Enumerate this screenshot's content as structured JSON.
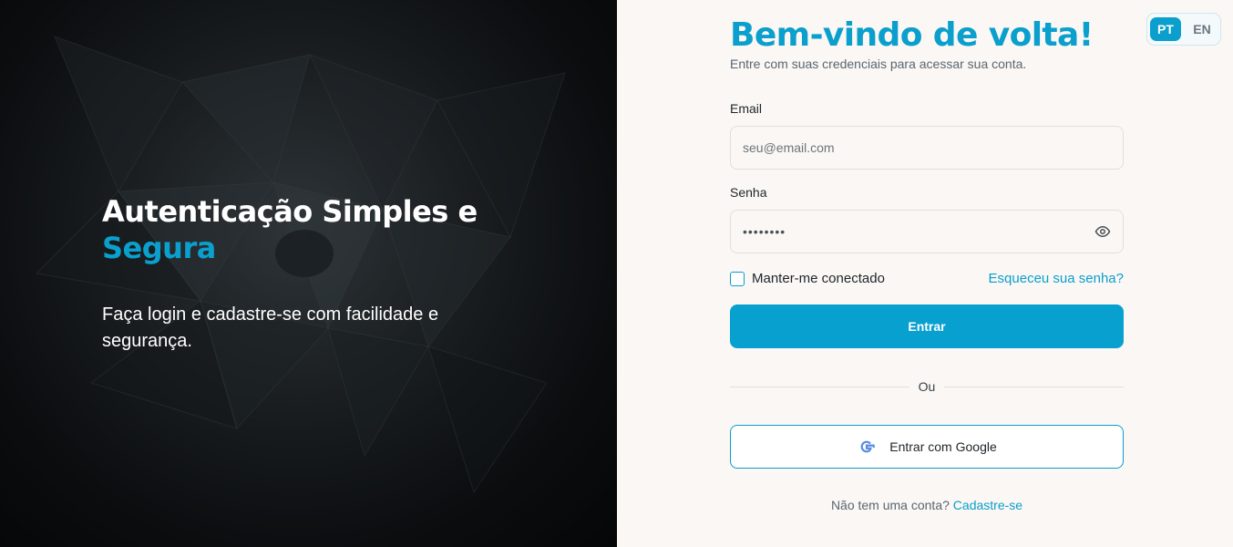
{
  "hero": {
    "title_line1": "Autenticação Simples e",
    "title_accent": "Segura",
    "subtitle": "Faça login e cadastre-se com facilidade e segurança."
  },
  "language": {
    "options": [
      "PT",
      "EN"
    ],
    "selected": "PT"
  },
  "form": {
    "title": "Bem-vindo de volta!",
    "subtitle": "Entre com suas credenciais para acessar sua conta.",
    "email_label": "Email",
    "email_placeholder": "seu@email.com",
    "password_label": "Senha",
    "password_value": "••••••••",
    "remember_label": "Manter-me conectado",
    "forgot_link": "Esqueceu sua senha?",
    "submit_label": "Entrar",
    "divider_text": "Ou",
    "google_label": "Entrar com Google",
    "signup_prompt": "Não tem uma conta?",
    "signup_link": "Cadastre-se"
  },
  "icons": [
    "eye-icon",
    "google-icon"
  ],
  "colors": {
    "accent": "#0a9fcc",
    "hero_background": "#0b0d0f",
    "form_background": "#faf7f4"
  }
}
